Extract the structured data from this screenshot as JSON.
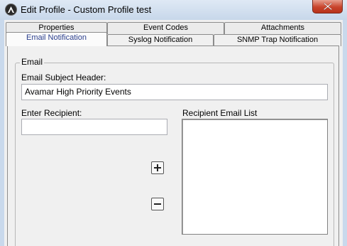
{
  "window": {
    "title": "Edit Profile - Custom Profile test"
  },
  "tabs": {
    "row1": [
      {
        "label": "Properties"
      },
      {
        "label": "Event Codes"
      },
      {
        "label": "Attachments"
      }
    ],
    "row2": [
      {
        "label": "Email Notification",
        "active": true
      },
      {
        "label": "Syslog Notification"
      },
      {
        "label": "SNMP Trap Notification"
      }
    ]
  },
  "email_group": {
    "legend": "Email",
    "subject_header_label": "Email Subject Header:",
    "subject_header_value": "Avamar  High Priority Events",
    "enter_recipient_label": "Enter Recipient:",
    "enter_recipient_value": "",
    "recipient_list_label": "Recipient Email List",
    "recipient_list_items": []
  },
  "icons": {
    "app": "avamar-logo-icon",
    "close": "close-icon",
    "add": "plus-icon",
    "remove": "minus-icon"
  },
  "colors": {
    "active_tab_text": "#2b3f8e",
    "close_button": "#c8442c"
  }
}
